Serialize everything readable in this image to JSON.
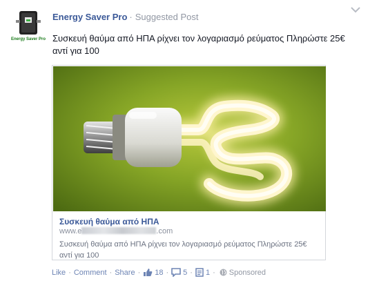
{
  "post": {
    "page_name": "Energy Saver Pro",
    "separator": "·",
    "post_type": "Suggested Post",
    "message": "Συσκευή θαύμα από ΗΠΑ ρίχνει τον λογαριασμό ρεύματος Πληρώστε 25€ αντί για 100",
    "avatar_label": "Energy Saver Pro"
  },
  "card": {
    "title": "Συσκευή θαύμα από ΗΠΑ",
    "url_prefix": "www.e",
    "url_suffix": ".com",
    "description": "Συσκευή θαύμα από ΗΠΑ ρίχνει τον λογαριασμό ρεύματος Πληρώστε 25€ αντί για 100",
    "image_icon": "dollar-sign-light-bulb"
  },
  "actions": {
    "like": "Like",
    "comment": "Comment",
    "share": "Share",
    "likes_count": "18",
    "comments_count": "5",
    "shares_count": "1",
    "sponsored": "Sponsored",
    "dot": "·"
  },
  "colors": {
    "link": "#3b5998",
    "muted": "#9197a3",
    "image_bg": "#6f8f1c"
  }
}
